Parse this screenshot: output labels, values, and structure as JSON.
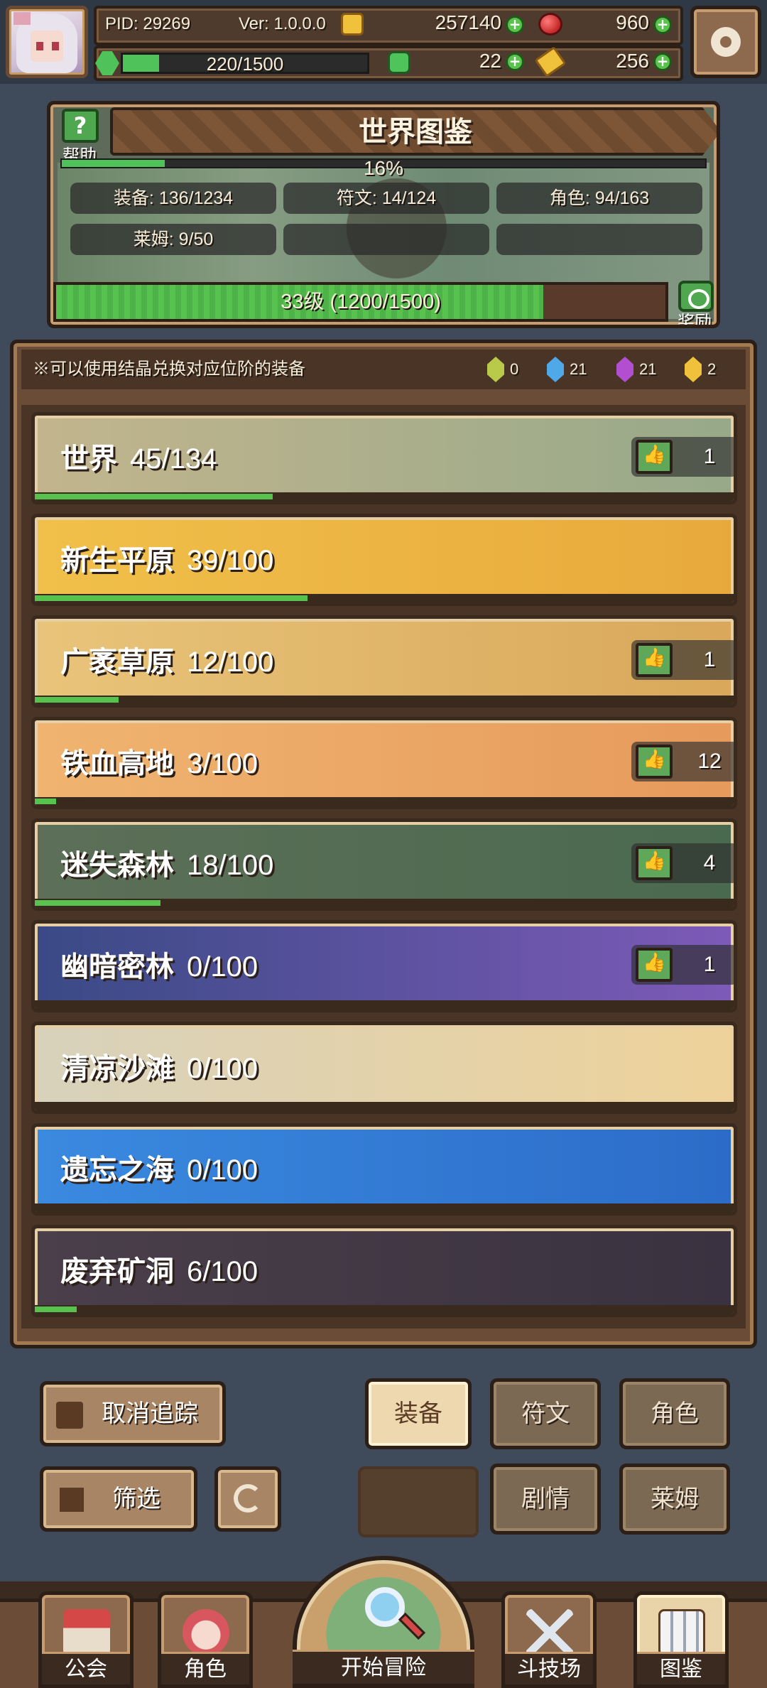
{
  "topbar": {
    "pid": "PID: 29269",
    "version": "Ver: 1.0.0.0",
    "gold": "257140",
    "gems": "960",
    "stamina": "220/1500",
    "stamina_fraction": 0.147,
    "clover": "22",
    "keys": "256"
  },
  "compendium": {
    "title": "世界图鉴",
    "help_label": "帮助",
    "progress_pct": "16%",
    "progress_fraction": 0.16,
    "stats": [
      "装备: 136/1234",
      "符文: 14/124",
      "角色: 94/163",
      "莱姆: 9/50"
    ],
    "level_text": "33级 (1200/1500)",
    "level_fraction": 0.8,
    "reward_label": "奖励"
  },
  "notice": {
    "text": "※可以使用结晶兑换对应位阶的装备",
    "crystals": [
      {
        "color": "#b9c94a",
        "count": "0"
      },
      {
        "color": "#4fa8e8",
        "count": "21"
      },
      {
        "color": "#b24fd0",
        "count": "21"
      },
      {
        "color": "#f0c23c",
        "count": "2"
      }
    ]
  },
  "regions": [
    {
      "name": "世界",
      "count": "45/134",
      "fraction": 0.34,
      "tracked": "1",
      "bg": [
        "#c2b58d",
        "#97a98a"
      ]
    },
    {
      "name": "新生平原",
      "count": "39/100",
      "fraction": 0.39,
      "tracked": "",
      "bg": [
        "#f0c04a",
        "#e8a93c"
      ]
    },
    {
      "name": "广袤草原",
      "count": "12/100",
      "fraction": 0.12,
      "tracked": "1",
      "bg": [
        "#e8c47a",
        "#d9a85a"
      ]
    },
    {
      "name": "铁血高地",
      "count": "3/100",
      "fraction": 0.03,
      "tracked": "12",
      "bg": [
        "#f0b470",
        "#e69a5c"
      ]
    },
    {
      "name": "迷失森林",
      "count": "18/100",
      "fraction": 0.18,
      "tracked": "4",
      "bg": [
        "#5d6f58",
        "#4a6a4f"
      ]
    },
    {
      "name": "幽暗密林",
      "count": "0/100",
      "fraction": 0,
      "tracked": "1",
      "bg": [
        "#3a4a86",
        "#7d5ab8"
      ]
    },
    {
      "name": "清凉沙滩",
      "count": "0/100",
      "fraction": 0,
      "tracked": "",
      "bg": [
        "#d8d2bc",
        "#eed29a"
      ]
    },
    {
      "name": "遗忘之海",
      "count": "0/100",
      "fraction": 0,
      "tracked": "",
      "bg": [
        "#3a8ae0",
        "#2c6cc8"
      ]
    },
    {
      "name": "废弃矿洞",
      "count": "6/100",
      "fraction": 0.06,
      "tracked": "",
      "bg": [
        "#4a3f4a",
        "#3a3240"
      ]
    }
  ],
  "controls": {
    "untrack": "取消追踪",
    "filter": "筛选",
    "equip": "装备",
    "rune": "符文",
    "role": "角色",
    "story": "剧情",
    "lime": "莱姆"
  },
  "nav": {
    "guild": "公会",
    "role": "角色",
    "adventure": "开始冒险",
    "arena": "斗技场",
    "compendium": "图鉴"
  }
}
